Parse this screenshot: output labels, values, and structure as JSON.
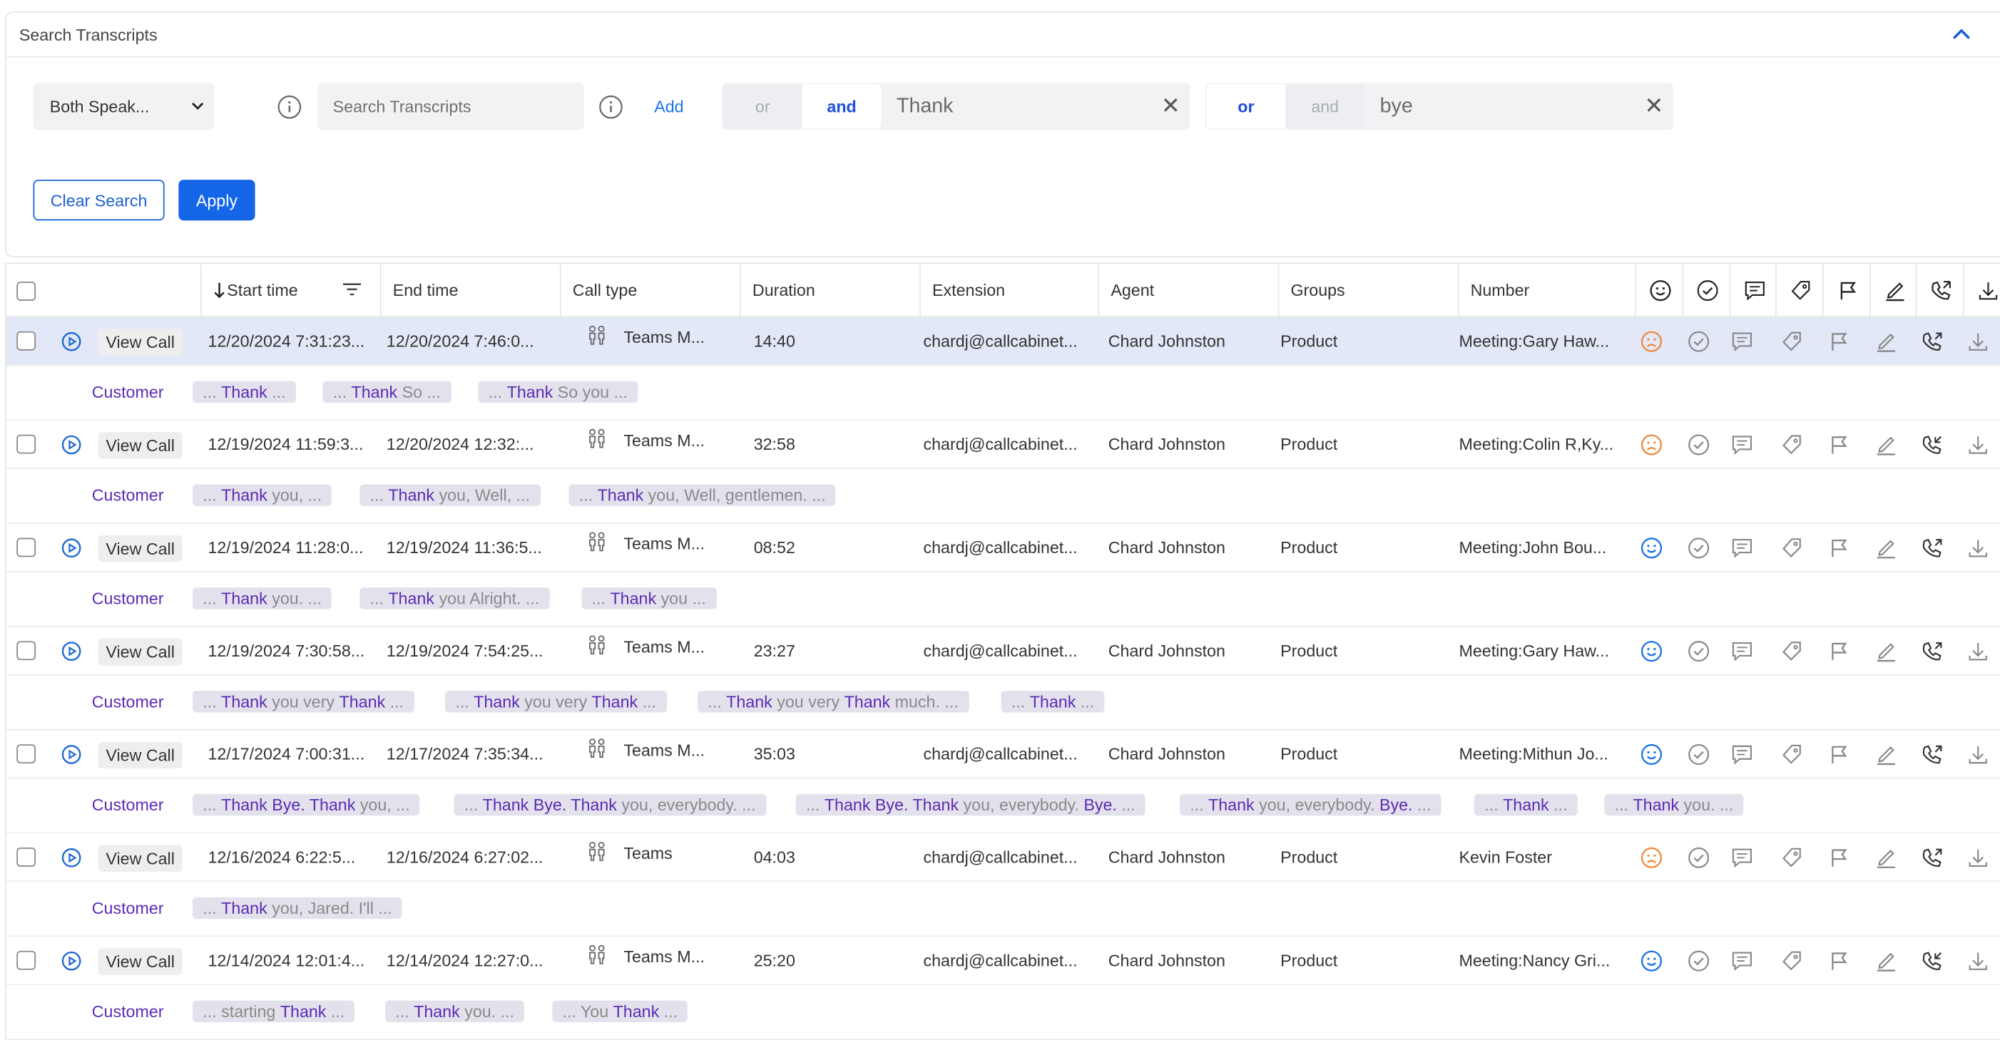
{
  "search_panel": {
    "title": "Search Transcripts",
    "speaker_select": "Both Speak...",
    "search_placeholder": "Search Transcripts",
    "add_label": "Add",
    "terms": [
      {
        "or_label": "or",
        "and_label": "and",
        "active": "and",
        "value": "Thank"
      },
      {
        "or_label": "or",
        "and_label": "and",
        "active": "or",
        "value": "bye"
      }
    ],
    "clear_label": "Clear Search",
    "apply_label": "Apply"
  },
  "table": {
    "columns": {
      "start": "Start time",
      "end": "End time",
      "call_type": "Call type",
      "duration": "Duration",
      "extension": "Extension",
      "agent": "Agent",
      "groups": "Groups",
      "number": "Number"
    },
    "icon_columns": [
      "smiley-icon",
      "check-circle-icon",
      "comment-icon",
      "tag-icon",
      "flag-icon",
      "sign-icon",
      "phone-icon",
      "download-icon"
    ],
    "view_call_label": "View Call",
    "customer_label": "Customer",
    "rows": [
      {
        "start": "12/20/2024 7:31:23...",
        "end": "12/20/2024 7:46:0...",
        "call_type": "Teams M...",
        "duration": "14:40",
        "extension": "chardj@callcabinet...",
        "agent": "Chard Johnston",
        "groups": "Product",
        "number": "Meeting:Gary Haw...",
        "sentiment": "negative",
        "direction": "outgoing",
        "snippets": [
          [
            "... ",
            "Thank",
            " ..."
          ],
          [
            "... ",
            "Thank",
            " So ..."
          ],
          [
            "... ",
            "Thank",
            " So you ..."
          ]
        ]
      },
      {
        "start": "12/19/2024 11:59:3...",
        "end": "12/20/2024 12:32:...",
        "call_type": "Teams M...",
        "duration": "32:58",
        "extension": "chardj@callcabinet...",
        "agent": "Chard Johnston",
        "groups": "Product",
        "number": "Meeting:Colin R,Ky...",
        "sentiment": "negative",
        "direction": "incoming",
        "snippets": [
          [
            "... ",
            "Thank",
            " you, ..."
          ],
          [
            "... ",
            "Thank",
            " you, Well, ..."
          ],
          [
            "... ",
            "Thank",
            " you, Well, gentlemen. ..."
          ]
        ]
      },
      {
        "start": "12/19/2024 11:28:0...",
        "end": "12/19/2024 11:36:5...",
        "call_type": "Teams M...",
        "duration": "08:52",
        "extension": "chardj@callcabinet...",
        "agent": "Chard Johnston",
        "groups": "Product",
        "number": "Meeting:John Bou...",
        "sentiment": "positive",
        "direction": "outgoing",
        "snippets": [
          [
            "... ",
            "Thank",
            " you. ..."
          ],
          [
            "... ",
            "Thank",
            " you Alright. ..."
          ],
          [
            "... ",
            "Thank",
            " you ..."
          ]
        ]
      },
      {
        "start": "12/19/2024 7:30:58...",
        "end": "12/19/2024 7:54:25...",
        "call_type": "Teams M...",
        "duration": "23:27",
        "extension": "chardj@callcabinet...",
        "agent": "Chard Johnston",
        "groups": "Product",
        "number": "Meeting:Gary Haw...",
        "sentiment": "positive",
        "direction": "outgoing",
        "snippets": [
          [
            "... ",
            "Thank",
            " you very ",
            "Thank",
            " ..."
          ],
          [
            "... ",
            "Thank",
            " you very ",
            "Thank",
            " ..."
          ],
          [
            "... ",
            "Thank",
            " you very ",
            "Thank",
            " much. ..."
          ],
          [
            "... ",
            "Thank",
            " ..."
          ]
        ]
      },
      {
        "start": "12/17/2024 7:00:31...",
        "end": "12/17/2024 7:35:34...",
        "call_type": "Teams M...",
        "duration": "35:03",
        "extension": "chardj@callcabinet...",
        "agent": "Chard Johnston",
        "groups": "Product",
        "number": "Meeting:Mithun Jo...",
        "sentiment": "positive",
        "direction": "outgoing",
        "snippets": [
          [
            "... ",
            "Thank Bye. Thank",
            " you, ..."
          ],
          [
            "... ",
            "Thank Bye. Thank",
            " you, everybody. ..."
          ],
          [
            "... ",
            "Thank Bye. Thank",
            " you, everybody. ",
            "Bye.",
            " ..."
          ],
          [
            "... ",
            "Thank",
            " you, everybody. ",
            "Bye.",
            " ..."
          ],
          [
            "... ",
            "Thank",
            " ..."
          ],
          [
            "... ",
            "Thank",
            " you. ..."
          ]
        ]
      },
      {
        "start": "12/16/2024 6:22:5...",
        "end": "12/16/2024 6:27:02...",
        "call_type": "Teams",
        "duration": "04:03",
        "extension": "chardj@callcabinet...",
        "agent": "Chard Johnston",
        "groups": "Product",
        "number": "Kevin Foster",
        "sentiment": "negative",
        "direction": "outgoing",
        "snippets": [
          [
            "... ",
            "Thank",
            " you, Jared. I'll ..."
          ]
        ]
      },
      {
        "start": "12/14/2024 12:01:4...",
        "end": "12/14/2024 12:27:0...",
        "call_type": "Teams M...",
        "duration": "25:20",
        "extension": "chardj@callcabinet...",
        "agent": "Chard Johnston",
        "groups": "Product",
        "number": "Meeting:Nancy Gri...",
        "sentiment": "positive",
        "direction": "incoming",
        "snippets": [
          [
            "... starting ",
            "Thank",
            " ..."
          ],
          [
            "... ",
            "Thank",
            " you. ..."
          ],
          [
            "... You ",
            "Thank",
            " ..."
          ]
        ]
      }
    ]
  },
  "colors": {
    "accent": "#1466e6",
    "highlight": "#5b2bb5",
    "positive": "#1a73e8",
    "negative": "#f0883e"
  }
}
